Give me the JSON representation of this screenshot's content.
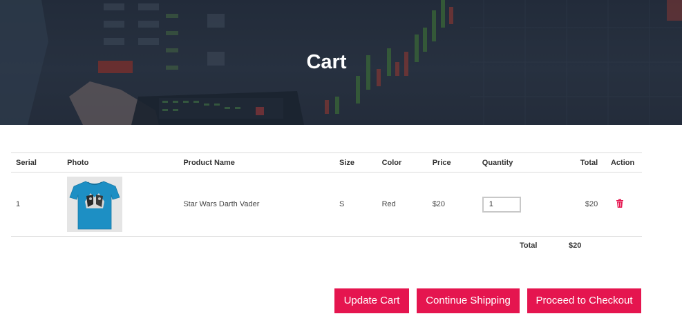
{
  "banner": {
    "title": "Cart"
  },
  "table": {
    "headers": {
      "serial": "Serial",
      "photo": "Photo",
      "product_name": "Product Name",
      "size": "Size",
      "color": "Color",
      "price": "Price",
      "quantity": "Quantity",
      "total": "Total",
      "action": "Action"
    },
    "rows": [
      {
        "serial": "1",
        "photo_icon": "tshirt-image",
        "product_name": "Star Wars Darth Vader",
        "size": "S",
        "color": "Red",
        "price": "$20",
        "quantity": "1",
        "total": "$20",
        "action_icon": "trash-icon"
      }
    ]
  },
  "summary": {
    "label": "Total",
    "value": "$20"
  },
  "buttons": {
    "update": "Update Cart",
    "continue": "Continue Shipping",
    "checkout": "Proceed to Checkout"
  },
  "colors": {
    "accent": "#e5154f",
    "banner_dark": "#2c3545"
  }
}
